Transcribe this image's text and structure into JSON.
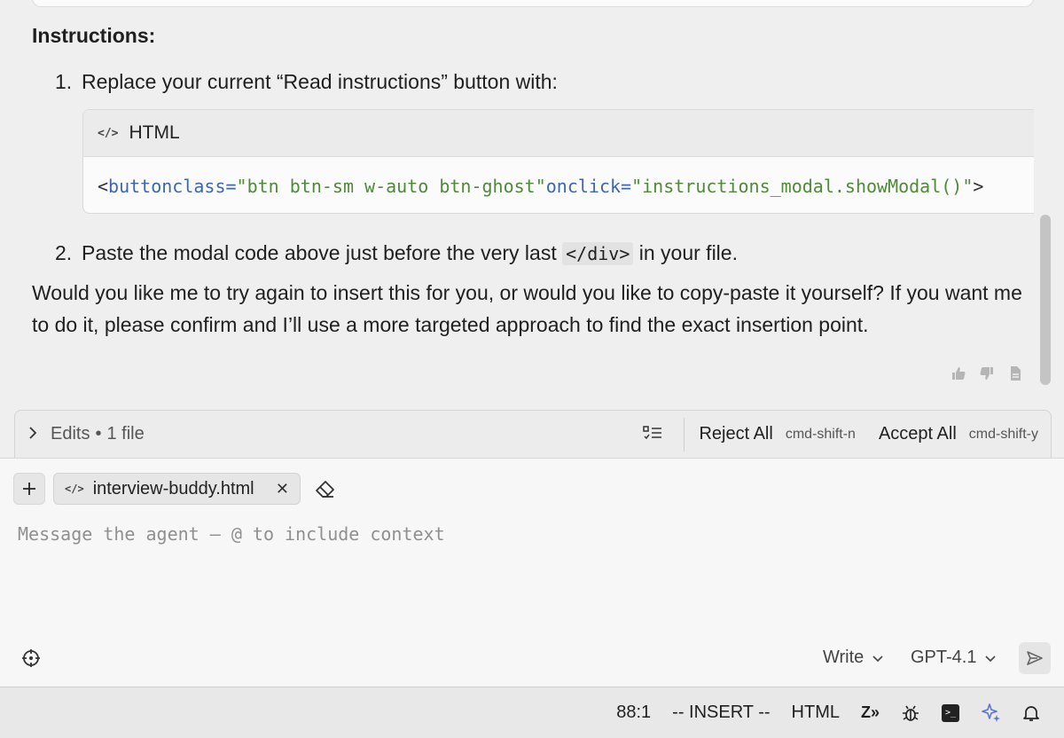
{
  "chat": {
    "heading": "Instructions:",
    "step1": {
      "num": "1.",
      "text": "Replace your current “Read instructions” button with:"
    },
    "code_block": {
      "lang": "HTML",
      "lang_icon": "code-icon",
      "line": {
        "open": "<",
        "tag": "button",
        "attr1": " class=",
        "val1": "\"btn btn-sm w-auto btn-ghost\"",
        "attr2": " onclick=",
        "val2": "\"instructions_modal.showModal()\"",
        "tail": ">"
      }
    },
    "step2": {
      "num": "2.",
      "before": "Paste the modal code above just before the very last ",
      "code": "</div>",
      "after": " in your file."
    },
    "paragraph": "Would you like me to try again to insert this for you, or would you like to copy-paste it yourself? If you want me to do it, please confirm and I’ll use a more targeted approach to find the exact insertion point.",
    "feedback_icons": [
      "thumbs-up-icon",
      "thumbs-down-icon",
      "copy-icon"
    ]
  },
  "edits": {
    "label": "Edits",
    "separator": "•",
    "count": "1 file",
    "reject_label": "Reject All",
    "reject_shortcut": "cmd-shift-n",
    "accept_label": "Accept All",
    "accept_shortcut": "cmd-shift-y"
  },
  "composer": {
    "file_chip": "interview-buddy.html",
    "placeholder": "Message the agent – @ to include context",
    "mode": "Write",
    "model": "GPT-4.1"
  },
  "status": {
    "position": "88:1",
    "mode": "-- INSERT --",
    "language": "HTML",
    "zed_label": "Z»"
  },
  "colors": {
    "code_tag": "#3b67b0",
    "code_string": "#4e8a37",
    "ai_icon": "#5b73d8"
  }
}
